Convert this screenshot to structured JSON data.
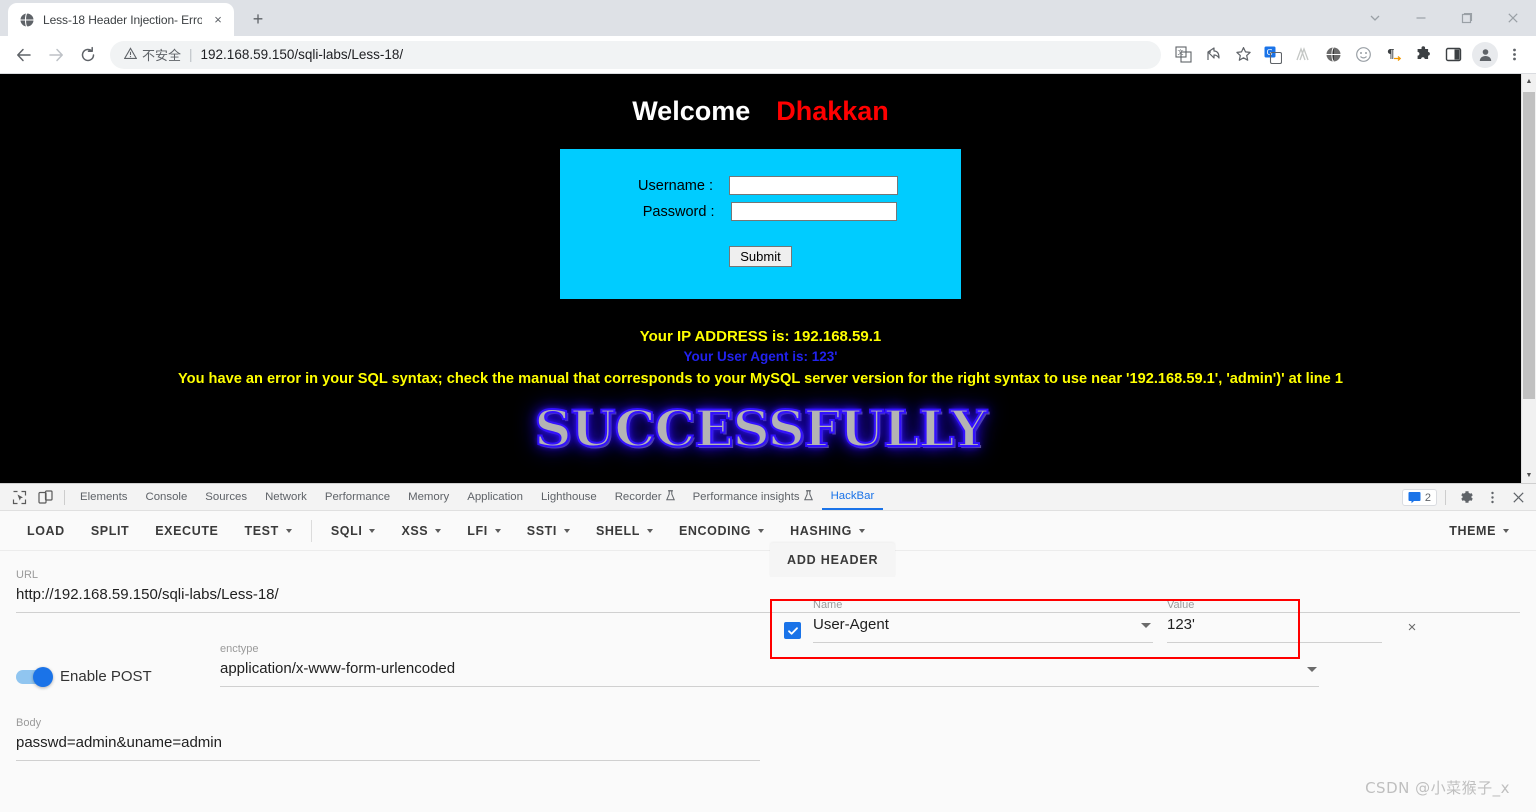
{
  "browser": {
    "tab": {
      "title": "Less-18 Header Injection- Erro",
      "favicon": "globe-icon",
      "close": "×"
    },
    "new_tab_label": "+",
    "window_controls": {
      "minimize": "–",
      "maximize": "☐",
      "close": "×",
      "more": "∨"
    },
    "nav": {
      "back": "←",
      "forward": "→",
      "reload": "⟳"
    },
    "omnibox": {
      "security_label": "不安全",
      "separator": "|",
      "url": "192.168.59.150/sqli-labs/Less-18/"
    },
    "toolbar_icons": [
      "translate-icon",
      "share-icon",
      "bookmark-star-icon",
      "google-translate-icon",
      "extension-a-icon",
      "globe-ext-icon",
      "smiley-ext-icon",
      "paragraph-ext-icon",
      "puzzle-icon",
      "sidepanel-icon",
      "profile-avatar-icon",
      "chrome-menu-icon"
    ]
  },
  "page": {
    "welcome": "Welcome",
    "welcome_name": "Dhakkan",
    "form": {
      "username_label": "Username :",
      "username_value": "",
      "password_label": "Password :",
      "password_value": "",
      "submit_label": "Submit",
      "box_color": "#00ccff"
    },
    "messages": {
      "ip": "Your IP ADDRESS is: 192.168.59.1",
      "user_agent": "Your User Agent is: 123'",
      "sql_error": "You have an error in your SQL syntax; check the manual that corresponds to your MySQL server version for the right syntax to use near '192.168.59.1', 'admin')' at line 1",
      "ip_color": "#ffff00",
      "ua_color": "#2222ee",
      "error_color": "#ffff00"
    },
    "banner_text": "SUCCESSFULLY"
  },
  "devtools": {
    "left_icons": [
      "inspect-element-icon",
      "device-toolbar-icon"
    ],
    "tabs": [
      {
        "label": "Elements",
        "active": false,
        "warn": false
      },
      {
        "label": "Console",
        "active": false,
        "warn": false
      },
      {
        "label": "Sources",
        "active": false,
        "warn": false
      },
      {
        "label": "Network",
        "active": false,
        "warn": false
      },
      {
        "label": "Performance",
        "active": false,
        "warn": false
      },
      {
        "label": "Memory",
        "active": false,
        "warn": false
      },
      {
        "label": "Application",
        "active": false,
        "warn": false
      },
      {
        "label": "Lighthouse",
        "active": false,
        "warn": false
      },
      {
        "label": "Recorder",
        "active": false,
        "warn": true
      },
      {
        "label": "Performance insights",
        "active": false,
        "warn": true
      },
      {
        "label": "HackBar",
        "active": true,
        "warn": false
      }
    ],
    "issues_count": "2",
    "right_icons": [
      "issues-icon",
      "settings-gear-icon",
      "more-options-icon",
      "close-devtools-icon"
    ]
  },
  "hackbar": {
    "buttons": [
      {
        "label": "LOAD",
        "dropdown": false
      },
      {
        "label": "SPLIT",
        "dropdown": false
      },
      {
        "label": "EXECUTE",
        "dropdown": false
      },
      {
        "label": "TEST",
        "dropdown": true
      },
      {
        "label": "SQLI",
        "dropdown": true
      },
      {
        "label": "XSS",
        "dropdown": true
      },
      {
        "label": "LFI",
        "dropdown": true
      },
      {
        "label": "SSTI",
        "dropdown": true
      },
      {
        "label": "SHELL",
        "dropdown": true
      },
      {
        "label": "ENCODING",
        "dropdown": true
      },
      {
        "label": "HASHING",
        "dropdown": true
      }
    ],
    "theme": {
      "label": "THEME",
      "dropdown": true
    },
    "url_field": {
      "label": "URL",
      "value": "http://192.168.59.150/sqli-labs/Less-18/"
    },
    "post": {
      "toggle_label": "Enable POST",
      "enabled": true,
      "enctype_label": "enctype",
      "enctype_value": "application/x-www-form-urlencoded"
    },
    "body_field": {
      "label": "Body",
      "value": "passwd=admin&uname=admin"
    },
    "add_header_button": "ADD HEADER",
    "header_row": {
      "checked": true,
      "name_label": "Name",
      "name_value": "User-Agent",
      "value_label": "Value",
      "value_value": "123'",
      "remove_label": "×",
      "highlight_color": "#ff0000"
    }
  },
  "watermark": "CSDN @小菜猴子_x"
}
